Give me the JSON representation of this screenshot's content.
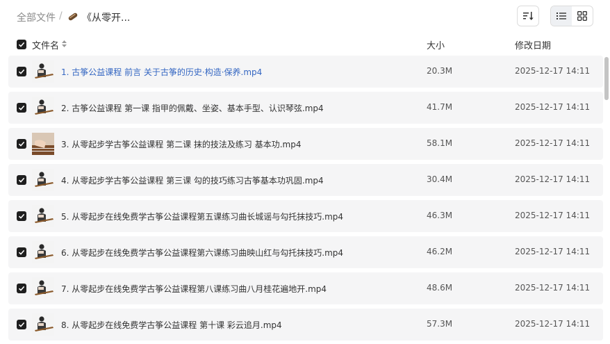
{
  "breadcrumb": {
    "root": "全部文件",
    "separator": "/",
    "current": "《从零开..."
  },
  "columns": {
    "name": "文件名",
    "size": "大小",
    "modified": "修改日期"
  },
  "colors": {
    "link": "#3466c2",
    "row_bg": "#f5f5f6",
    "checkbox": "#1f1f1f"
  },
  "files": [
    {
      "name": "1. 古筝公益课程 前言 关于古筝的历史·构造·保养.mp4",
      "size": "20.3M",
      "date": "2025-12-17 14:11",
      "thumb": "player",
      "highlight": true
    },
    {
      "name": "2. 古筝公益课程 第一课 指甲的佩戴、坐姿、基本手型、认识琴弦.mp4",
      "size": "41.7M",
      "date": "2025-12-17 14:11",
      "thumb": "player",
      "highlight": false
    },
    {
      "name": "3. 从零起步学古筝公益课程  第二课  抹的技法及练习 基本功.mp4",
      "size": "58.1M",
      "date": "2025-12-17 14:11",
      "thumb": "hands",
      "highlight": false
    },
    {
      "name": "4. 从零起步学古筝公益课程 第三课 勾的技巧练习古筝基本功巩固.mp4",
      "size": "30.4M",
      "date": "2025-12-17 14:11",
      "thumb": "player",
      "highlight": false
    },
    {
      "name": "5. 从零起步在线免费学古筝公益课程第五课练习曲长城谣与勾托抹技巧.mp4",
      "size": "46.3M",
      "date": "2025-12-17 14:11",
      "thumb": "player",
      "highlight": false
    },
    {
      "name": "6. 从零起步在线免费学古筝公益课程第六课练习曲映山红与勾托抹技巧.mp4",
      "size": "46.2M",
      "date": "2025-12-17 14:11",
      "thumb": "player",
      "highlight": false
    },
    {
      "name": "7. 从零起步在线免费学古筝公益课程第八课练习曲八月桂花遍地开.mp4",
      "size": "48.6M",
      "date": "2025-12-17 14:11",
      "thumb": "player",
      "highlight": false
    },
    {
      "name": "8. 从零起步在线免费学古筝公益课程 第十课 彩云追月.mp4",
      "size": "57.3M",
      "date": "2025-12-17 14:11",
      "thumb": "player",
      "highlight": false
    }
  ]
}
